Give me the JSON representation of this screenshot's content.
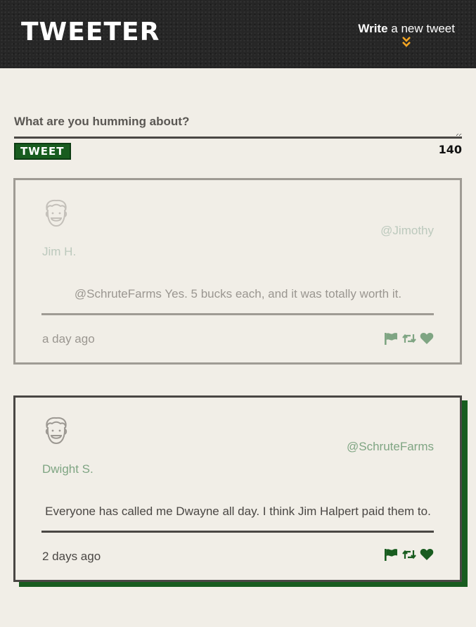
{
  "header": {
    "brand": "TWEETER",
    "compose_toggle": {
      "bold_label": "Write",
      "rest_label": " a new tweet",
      "icon": "chevron-double-down-icon",
      "icon_color": "#f5a623"
    }
  },
  "compose": {
    "label": "What are you humming about?",
    "input_value": "",
    "button_label": "TWEET",
    "counter": "140"
  },
  "colors": {
    "background": "#f1eee7",
    "header_background": "#262626",
    "accent_green": "#185c1f",
    "muted_green": "#7fa583",
    "text": "#4a4744"
  },
  "tweets": [
    {
      "display_name": "Jim H.",
      "handle": "@Jimothy",
      "text": "@SchruteFarms Yes. 5 bucks each, and it was totally worth it.",
      "timestamp": "a day ago",
      "actions": [
        "flag-icon",
        "retweet-icon",
        "heart-icon"
      ]
    },
    {
      "display_name": "Dwight S.",
      "handle": "@SchruteFarms",
      "text": "Everyone has called me Dwayne all day. I think Jim Halpert paid them to.",
      "timestamp": "2 days ago",
      "actions": [
        "flag-icon",
        "retweet-icon",
        "heart-icon"
      ]
    }
  ]
}
